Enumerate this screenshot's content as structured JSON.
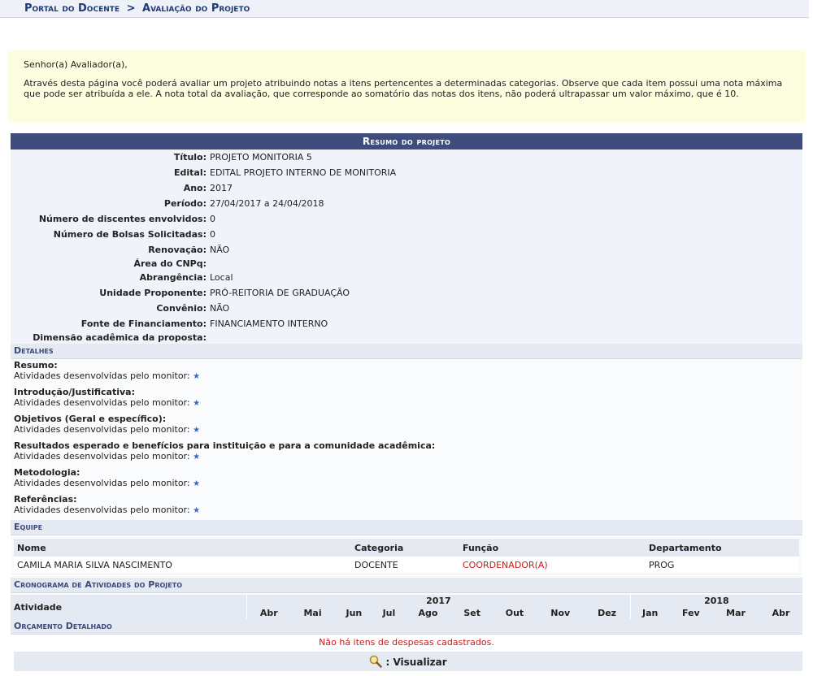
{
  "breadcrumb": {
    "portal": "Portal do Docente",
    "separator": ">",
    "page": "Avaliação do Projeto"
  },
  "notice": {
    "greeting": "Senhor(a) Avaliador(a),",
    "text": "Através desta página você poderá avaliar um projeto atribuindo notas a itens pertencentes a determinadas categorias. Observe que cada item possui uma nota máxima que pode ser atribuída a ele. A nota total da avaliação, que corresponde ao somatório das notas dos itens, não poderá ultrapassar um valor máximo, que é 10."
  },
  "summary": {
    "title": "Resumo do projeto",
    "fields": [
      {
        "label": "Título:",
        "value": "PROJETO MONITORIA 5"
      },
      {
        "label": "Edital:",
        "value": "EDITAL PROJETO INTERNO DE MONITORIA"
      },
      {
        "label": "Ano:",
        "value": "2017"
      },
      {
        "label": "Período:",
        "value": "27/04/2017 a 24/04/2018"
      },
      {
        "label": "Número de discentes envolvidos:",
        "value": "0"
      },
      {
        "label": "Número de Bolsas Solicitadas:",
        "value": "0"
      },
      {
        "label": "Renovação:",
        "value": "NÃO"
      },
      {
        "label": "Área do CNPq:",
        "value": ""
      },
      {
        "label": "Abrangência:",
        "value": "Local"
      },
      {
        "label": "Unidade Proponente:",
        "value": "PRÓ-REITORIA DE GRADUAÇÃO"
      },
      {
        "label": "Convênio:",
        "value": "NÃO"
      },
      {
        "label": "Fonte de Financiamento:",
        "value": "FINANCIAMENTO INTERNO"
      },
      {
        "label": "Dimensão acadêmica da proposta:",
        "value": ""
      }
    ]
  },
  "details": {
    "heading": "Detalhes",
    "items": [
      {
        "label": "Resumo:",
        "text": "Atividades desenvolvidas pelo monitor:"
      },
      {
        "label": "Introdução/Justificativa:",
        "text": "Atividades desenvolvidas pelo monitor:"
      },
      {
        "label": "Objetivos (Geral e específico):",
        "text": "Atividades desenvolvidas pelo monitor:"
      },
      {
        "label": "Resultados esperado e benefícios para instituição e para a comunidade acadêmica:",
        "text": "Atividades desenvolvidas pelo monitor:"
      },
      {
        "label": "Metodologia:",
        "text": "Atividades desenvolvidas pelo monitor:"
      },
      {
        "label": "Referências:",
        "text": "Atividades desenvolvidas pelo monitor:"
      }
    ],
    "star_icon": "star-icon"
  },
  "team": {
    "heading": "Equipe",
    "columns": [
      "Nome",
      "Categoria",
      "Função",
      "Departamento"
    ],
    "rows": [
      {
        "name": "CAMILA MARIA SILVA NASCIMENTO",
        "category": "DOCENTE",
        "role": "COORDENADOR(A)",
        "dept": "PROG"
      }
    ]
  },
  "schedule": {
    "heading": "Cronograma de Atividades do Projeto",
    "activity_label": "Atividade",
    "years": [
      {
        "year": "2017",
        "months": [
          "Abr",
          "Mai",
          "Jun",
          "Jul",
          "Ago",
          "Set",
          "Out",
          "Nov",
          "Dez"
        ]
      },
      {
        "year": "2018",
        "months": [
          "Jan",
          "Fev",
          "Mar",
          "Abr"
        ]
      }
    ]
  },
  "budget": {
    "heading": "Orçamento Detalhado",
    "empty_message": "Não há itens de despesas cadastrados."
  },
  "view_button": {
    "icon": "magnifier-icon",
    "label": ": Visualizar"
  },
  "colors": {
    "header_bg": "#3e4d7c",
    "accent_red": "#c51d1d",
    "notice_bg": "#fdfde0"
  }
}
